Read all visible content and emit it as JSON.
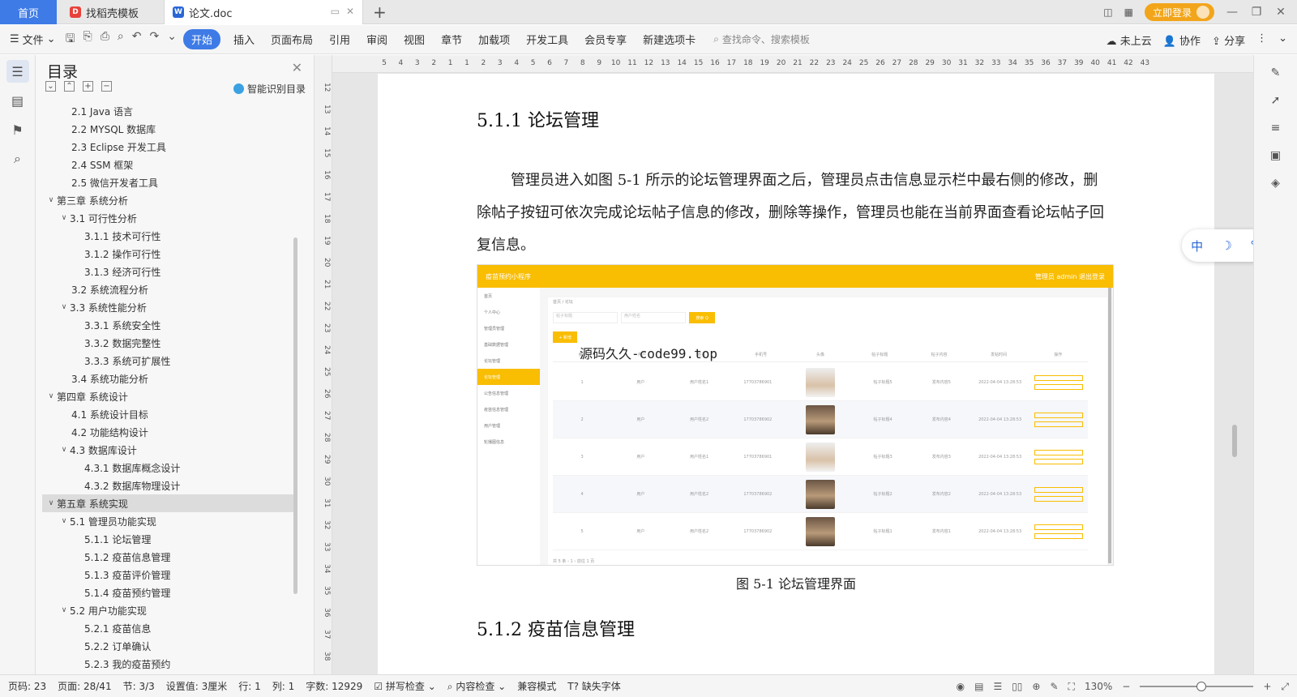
{
  "tabs": {
    "home": "首页",
    "templates": "找稻壳模板",
    "doc": "论文.doc",
    "new_tab": "+",
    "login": "立即登录"
  },
  "menubar": {
    "file": "文件",
    "items": [
      "开始",
      "插入",
      "页面布局",
      "引用",
      "审阅",
      "视图",
      "章节",
      "加载项",
      "开发工具",
      "会员专享",
      "新建选项卡"
    ],
    "search_placeholder": "查找命令、搜索模板",
    "cloud": "未上云",
    "collab": "协作",
    "share": "分享"
  },
  "toc": {
    "title": "目录",
    "smart": "智能识别目录",
    "items": [
      {
        "text": "2.1 Java 语言",
        "level": 2,
        "arrow": ""
      },
      {
        "text": "2.2 MYSQL 数据库",
        "level": 2,
        "arrow": ""
      },
      {
        "text": "2.3 Eclipse 开发工具",
        "level": 2,
        "arrow": ""
      },
      {
        "text": "2.4 SSM 框架",
        "level": 2,
        "arrow": ""
      },
      {
        "text": "2.5 微信开发者工具",
        "level": 2,
        "arrow": ""
      },
      {
        "text": "第三章 系统分析",
        "level": 1,
        "arrow": "∨"
      },
      {
        "text": "3.1 可行性分析",
        "level": 2,
        "arrow": "∨"
      },
      {
        "text": "3.1.1 技术可行性",
        "level": 3,
        "arrow": ""
      },
      {
        "text": "3.1.2 操作可行性",
        "level": 3,
        "arrow": ""
      },
      {
        "text": "3.1.3 经济可行性",
        "level": 3,
        "arrow": ""
      },
      {
        "text": "3.2 系统流程分析",
        "level": 2,
        "arrow": ""
      },
      {
        "text": "3.3 系统性能分析",
        "level": 2,
        "arrow": "∨"
      },
      {
        "text": "3.3.1 系统安全性",
        "level": 3,
        "arrow": ""
      },
      {
        "text": "3.3.2 数据完整性",
        "level": 3,
        "arrow": ""
      },
      {
        "text": "3.3.3 系统可扩展性",
        "level": 3,
        "arrow": ""
      },
      {
        "text": "3.4 系统功能分析",
        "level": 2,
        "arrow": ""
      },
      {
        "text": "第四章 系统设计",
        "level": 1,
        "arrow": "∨"
      },
      {
        "text": "4.1 系统设计目标",
        "level": 2,
        "arrow": ""
      },
      {
        "text": "4.2 功能结构设计",
        "level": 2,
        "arrow": ""
      },
      {
        "text": "4.3 数据库设计",
        "level": 2,
        "arrow": "∨"
      },
      {
        "text": "4.3.1 数据库概念设计",
        "level": 3,
        "arrow": ""
      },
      {
        "text": "4.3.2 数据库物理设计",
        "level": 3,
        "arrow": ""
      },
      {
        "text": "第五章 系统实现",
        "level": 1,
        "arrow": "∨",
        "selected": true
      },
      {
        "text": "5.1 管理员功能实现",
        "level": 2,
        "arrow": "∨"
      },
      {
        "text": "5.1.1 论坛管理",
        "level": 3,
        "arrow": ""
      },
      {
        "text": "5.1.2 疫苗信息管理",
        "level": 3,
        "arrow": ""
      },
      {
        "text": "5.1.3 疫苗评价管理",
        "level": 3,
        "arrow": ""
      },
      {
        "text": "5.1.4 疫苗预约管理",
        "level": 3,
        "arrow": ""
      },
      {
        "text": "5.2 用户功能实现",
        "level": 2,
        "arrow": "∨"
      },
      {
        "text": "5.2.1 疫苗信息",
        "level": 3,
        "arrow": ""
      },
      {
        "text": "5.2.2 订单确认",
        "level": 3,
        "arrow": ""
      },
      {
        "text": "5.2.3 我的疫苗预约",
        "level": 3,
        "arrow": ""
      }
    ]
  },
  "vruler": [
    "12",
    "13",
    "14",
    "15",
    "16",
    "17",
    "18",
    "19",
    "20",
    "21",
    "22",
    "23",
    "24",
    "25",
    "26",
    "27",
    "28",
    "29",
    "30",
    "31",
    "32",
    "33",
    "34",
    "35",
    "36",
    "37",
    "38"
  ],
  "hruler": [
    "5",
    "4",
    "3",
    "2",
    "1",
    "1",
    "2",
    "3",
    "4",
    "5",
    "6",
    "7",
    "8",
    "9",
    "10",
    "11",
    "12",
    "13",
    "14",
    "15",
    "16",
    "17",
    "18",
    "19",
    "20",
    "21",
    "22",
    "23",
    "24",
    "25",
    "26",
    "27",
    "28",
    "29",
    "30",
    "31",
    "32",
    "33",
    "34",
    "35",
    "36",
    "37",
    "39",
    "40",
    "41",
    "42",
    "43"
  ],
  "doc": {
    "heading1": "5.1.1  论坛管理",
    "paragraph": "管理员进入如图 5-1 所示的论坛管理界面之后，管理员点击信息显示栏中最右侧的修改，删除帖子按钮可依次完成论坛帖子信息的修改，删除等操作，管理员也能在当前界面查看论坛帖子回复信息。",
    "caption": "图 5-1  论坛管理界面",
    "heading2": "5.1.2  疫苗信息管理",
    "watermark": "源码久久-code99.top"
  },
  "figure": {
    "app_title": "疫苗预约小程序",
    "top_right": "管理员 admin    退出登录",
    "breadcrumb": "首页 / 论坛",
    "side": [
      "首页",
      "个人中心",
      "管理员管理",
      "基础数据管理",
      "论坛管理",
      "论坛管理",
      "公告信息管理",
      "疫苗信息管理",
      "用户管理",
      "轮播图信息"
    ],
    "filter1": "帖子标题",
    "filter2": "用户姓名",
    "search_btn": "搜索 Q",
    "add_btn": "+ 新增",
    "headers": [
      "索引",
      "用户",
      "姓名",
      "手机号",
      "头像",
      "帖子标题",
      "帖子内容",
      "发帖时间",
      "操作"
    ],
    "rows": [
      {
        "idx": "1",
        "role": "用户",
        "name": "用户姓名1",
        "phone": "17703786901",
        "avatar": "light",
        "title": "帖子标题5",
        "content": "发布内容5",
        "time": "2022-04-04 13:28:53"
      },
      {
        "idx": "2",
        "role": "用户",
        "name": "用户姓名2",
        "phone": "17703786902",
        "avatar": "dark",
        "title": "帖子标题4",
        "content": "发布内容4",
        "time": "2022-04-04 13:28:53"
      },
      {
        "idx": "3",
        "role": "用户",
        "name": "用户姓名1",
        "phone": "17703786901",
        "avatar": "light",
        "title": "帖子标题3",
        "content": "发布内容3",
        "time": "2022-04-04 13:28:53"
      },
      {
        "idx": "4",
        "role": "用户",
        "name": "用户姓名2",
        "phone": "17703786902",
        "avatar": "dark",
        "title": "帖子标题2",
        "content": "发布内容2",
        "time": "2022-04-04 13:28:53"
      },
      {
        "idx": "5",
        "role": "用户",
        "name": "用户姓名2",
        "phone": "17703786902",
        "avatar": "dark",
        "title": "帖子标题1",
        "content": "发布内容1",
        "time": "2022-04-04 13:28:53"
      }
    ],
    "pager": "共 5 条   ‹  1  ›   前往  1  页"
  },
  "ime": {
    "lang": "中",
    "moon": "☽",
    "punct": "°,",
    "arrow": "›"
  },
  "status": {
    "page_code": "页码: 23",
    "page": "页面: 28/41",
    "section": "节: 3/3",
    "setting": "设置值: 3厘米",
    "row": "行: 1",
    "col": "列: 1",
    "words": "字数: 12929",
    "spell": "拼写检查",
    "content_check": "内容检查",
    "compat": "兼容模式",
    "missing_font": "缺失字体",
    "zoom": "130%"
  },
  "colors": {
    "accent": "#3e7be6",
    "figure_yellow": "#f9bd02",
    "login": "#f2a51a"
  }
}
